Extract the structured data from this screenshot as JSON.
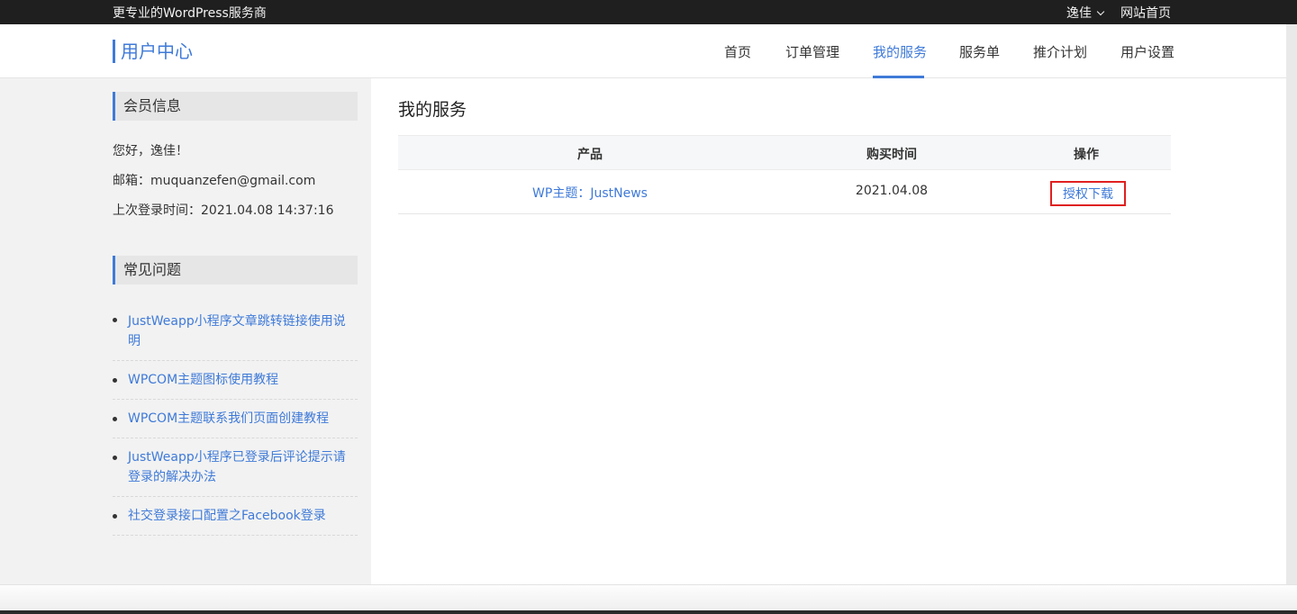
{
  "topbar": {
    "tagline": "更专业的WordPress服务商",
    "username": "逸佳",
    "site_home": "网站首页"
  },
  "header": {
    "brand": "用户中心",
    "nav": [
      "首页",
      "订单管理",
      "我的服务",
      "服务单",
      "推介计划",
      "用户设置"
    ],
    "active_nav": "我的服务"
  },
  "sidebar": {
    "member_title": "会员信息",
    "greeting": "您好，逸佳！",
    "email": "邮箱：muquanzefen@gmail.com",
    "last_login": "上次登录时间：2021.04.08 14:37:16",
    "faq_title": "常见问题",
    "faq": [
      "JustWeapp小程序文章跳转链接使用说明",
      "WPCOM主题图标使用教程",
      "WPCOM主题联系我们页面创建教程",
      "JustWeapp小程序已登录后评论提示请登录的解决办法",
      "社交登录接口配置之Facebook登录"
    ]
  },
  "main": {
    "title": "我的服务",
    "columns": [
      "产品",
      "购买时间",
      "操作"
    ],
    "rows": [
      {
        "product": "WP主题：JustNews",
        "date": "2021.04.08",
        "action": "授权下载"
      }
    ]
  },
  "colors": {
    "accent": "#3f7ad8",
    "highlight_border": "#e02020",
    "topbar": "#1f1f1f",
    "sidebar_bg": "#f2f2f2"
  }
}
